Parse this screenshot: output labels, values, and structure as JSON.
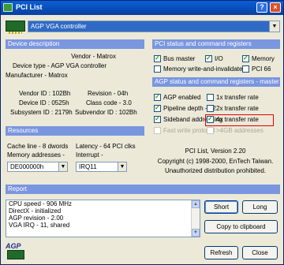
{
  "window": {
    "title": "PCI List",
    "help_glyph": "?",
    "close_glyph": "×"
  },
  "device": {
    "selected": "AGP VGA controller",
    "icon": "pci-card-icon"
  },
  "device_description": {
    "header": "Device description",
    "vendor_label": "Vendor -",
    "vendor": "Matrox",
    "type_label": "Device type -",
    "type": "AGP VGA controller",
    "manufacturer_label": "Manufacturer -",
    "manufacturer": "Matrox",
    "vendor_id": "Vendor ID : 102Bh",
    "device_id": "Device ID : 0525h",
    "subsystem_id": "Subsystem ID : 2179h",
    "revision": "Revision - 04h",
    "class_code": "Class code - 3.0",
    "subvendor_id": "Subvendor ID : 102Bh"
  },
  "resources": {
    "header": "Resources",
    "cache_line": "Cache line - 8 dwords",
    "latency": "Latency - 64 PCI clks",
    "memory_label": "Memory addresses -",
    "interrupt_label": "Interrupt -",
    "memory_value": "DE000000h",
    "interrupt_value": "IRQ11"
  },
  "pci_status": {
    "header": "PCI status and command registers",
    "items": [
      {
        "label": "Bus master",
        "checked": true
      },
      {
        "label": "I/O",
        "checked": true
      },
      {
        "label": "Memory",
        "checked": true
      },
      {
        "label": "Memory write-and-invalidate",
        "checked": false
      },
      {
        "label": "PCI 66",
        "checked": false
      }
    ]
  },
  "agp_status": {
    "header": "AGP status and command registers - master",
    "items": [
      {
        "label": "AGP enabled",
        "checked": true,
        "disabled": false
      },
      {
        "label": "1x transfer rate",
        "checked": false,
        "disabled": false
      },
      {
        "label": "Pipeline depth - 72",
        "checked": true,
        "disabled": false
      },
      {
        "label": "2x transfer rate",
        "checked": false,
        "disabled": false
      },
      {
        "label": "Sideband addressing",
        "checked": true,
        "disabled": false
      },
      {
        "label": "4x transfer rate",
        "checked": true,
        "disabled": false
      },
      {
        "label": "Fast write protocol",
        "checked": false,
        "disabled": true
      },
      {
        "label": ">4GB addresses",
        "checked": false,
        "disabled": true
      }
    ]
  },
  "about": {
    "line1": "PCI List, Version 2.20",
    "line2": "Copyright (c) 1998-2000, EnTech Taiwan.",
    "line3": "Unauthorized distribution prohibited."
  },
  "report": {
    "header": "Report",
    "lines": [
      "CPU speed - 906 MHz",
      "DirectX - initialized",
      "AGP revision - 2.00",
      "VGA IRQ - 11, shared"
    ],
    "short_label": "Short",
    "long_label": "Long",
    "copy_label": "Copy to clipboard"
  },
  "footer": {
    "logo_text": "AGP",
    "refresh_label": "Refresh",
    "close_label": "Close"
  }
}
